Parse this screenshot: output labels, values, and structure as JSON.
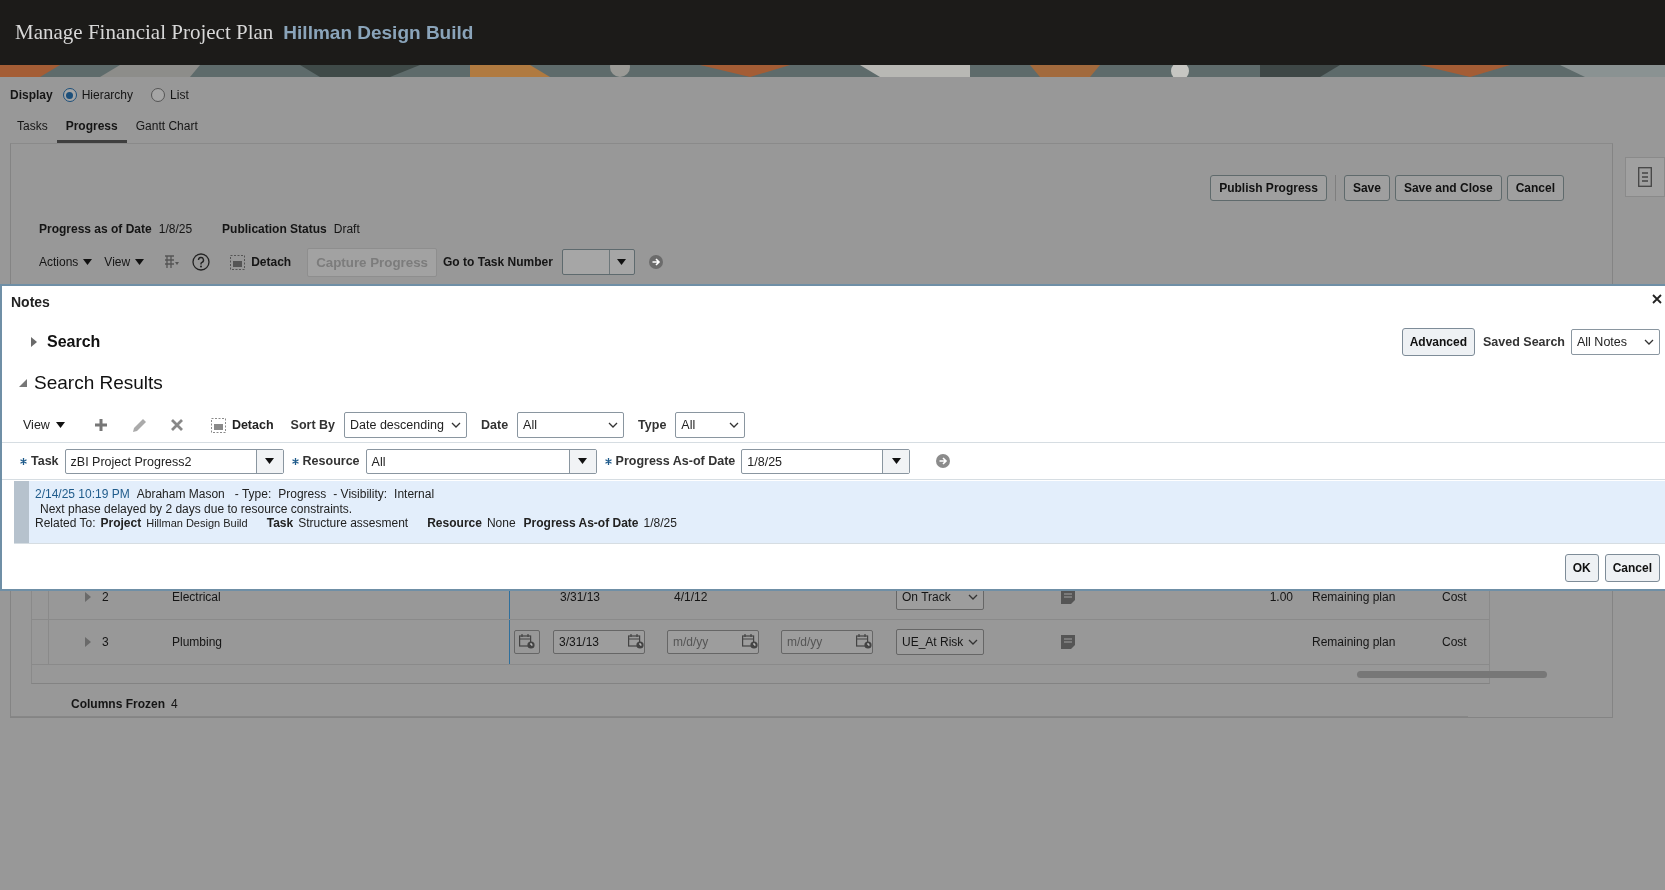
{
  "header": {
    "title": "Manage Financial Project Plan",
    "project": "Hillman Design Build"
  },
  "display": {
    "label": "Display",
    "options": [
      {
        "label": "Hierarchy",
        "selected": true
      },
      {
        "label": "List",
        "selected": false
      }
    ]
  },
  "tabs": [
    {
      "label": "Tasks",
      "selected": false
    },
    {
      "label": "Progress",
      "selected": true
    },
    {
      "label": "Gantt Chart",
      "selected": false
    }
  ],
  "page_buttons": [
    {
      "label": "Publish Progress",
      "kind": "primary"
    },
    {
      "label": "Save",
      "kind": "normal"
    },
    {
      "label": "Save and Close",
      "kind": "normal"
    },
    {
      "label": "Cancel",
      "kind": "normal"
    }
  ],
  "progress_info": [
    {
      "label": "Progress as of Date",
      "value": "1/8/25"
    },
    {
      "label": "Publication Status",
      "value": "Draft"
    }
  ],
  "toolbar": {
    "actions": "Actions",
    "view": "View",
    "detach": "Detach",
    "capture": {
      "label": "Capture Progress",
      "disabled": true
    },
    "goto_label": "Go to Task Number"
  },
  "table": {
    "rows": [
      {
        "number": "2",
        "name": "Electrical",
        "expanded": false,
        "cells": [
          {
            "kind": "empty"
          },
          {
            "kind": "text",
            "text": "3/31/13"
          },
          {
            "kind": "text",
            "text": "4/1/12"
          },
          {
            "kind": "empty"
          },
          {
            "kind": "select",
            "value": "On Track"
          },
          {
            "kind": "note"
          },
          {
            "kind": "number",
            "text": "1.00"
          },
          {
            "kind": "text",
            "text": "Remaining plan"
          },
          {
            "kind": "text",
            "text": "Cost"
          }
        ]
      },
      {
        "number": "3",
        "name": "Plumbing",
        "expanded": false,
        "cells": [
          {
            "kind": "calendar"
          },
          {
            "kind": "date",
            "value": "3/31/13"
          },
          {
            "kind": "date",
            "placeholder": "m/d/yy"
          },
          {
            "kind": "date",
            "placeholder": "m/d/yy"
          },
          {
            "kind": "select",
            "value": "UE_At Risk"
          },
          {
            "kind": "note"
          },
          {
            "kind": "empty"
          },
          {
            "kind": "text",
            "text": "Remaining plan"
          },
          {
            "kind": "text",
            "text": "Cost"
          }
        ]
      }
    ],
    "frozen_label": "Columns Frozen",
    "frozen_value": "4"
  },
  "dialog": {
    "title": "Notes",
    "search": {
      "label": "Search",
      "expanded": false,
      "advanced": "Advanced",
      "saved_search_label": "Saved Search",
      "saved_search": "All Notes"
    },
    "results": {
      "label": "Search Results",
      "expanded": true,
      "toolbar": {
        "view": "View",
        "detach": "Detach",
        "filters": [
          {
            "label": "Sort By",
            "value": "Date descending"
          },
          {
            "label": "Date",
            "value": "All"
          },
          {
            "label": "Type",
            "value": "All"
          }
        ]
      },
      "criteria": [
        {
          "label": "Task",
          "value": "zBI Project Progress2",
          "required": true
        },
        {
          "label": "Resource",
          "value": "All",
          "required": true
        },
        {
          "label": "Progress As-of Date",
          "value": "1/8/25",
          "required": true
        }
      ],
      "notes": [
        {
          "date": "2/14/25 10:19 PM",
          "author": "Abraham Mason",
          "type_label": "- Type:",
          "type": "Progress",
          "visibility_label": "- Visibility:",
          "visibility": "Internal",
          "text": "Next phase delayed by 2 days due to resource constraints.",
          "related_label": "Related To:",
          "related": [
            {
              "label": "Project",
              "value": "Hillman Design Build"
            },
            {
              "label": "Task",
              "value": "Structure assesment"
            },
            {
              "label": "Resource",
              "value": "None"
            },
            {
              "label": "Progress As-of Date",
              "value": "1/8/25"
            }
          ]
        }
      ]
    },
    "buttons": [
      {
        "label": "OK"
      },
      {
        "label": "Cancel"
      }
    ]
  }
}
